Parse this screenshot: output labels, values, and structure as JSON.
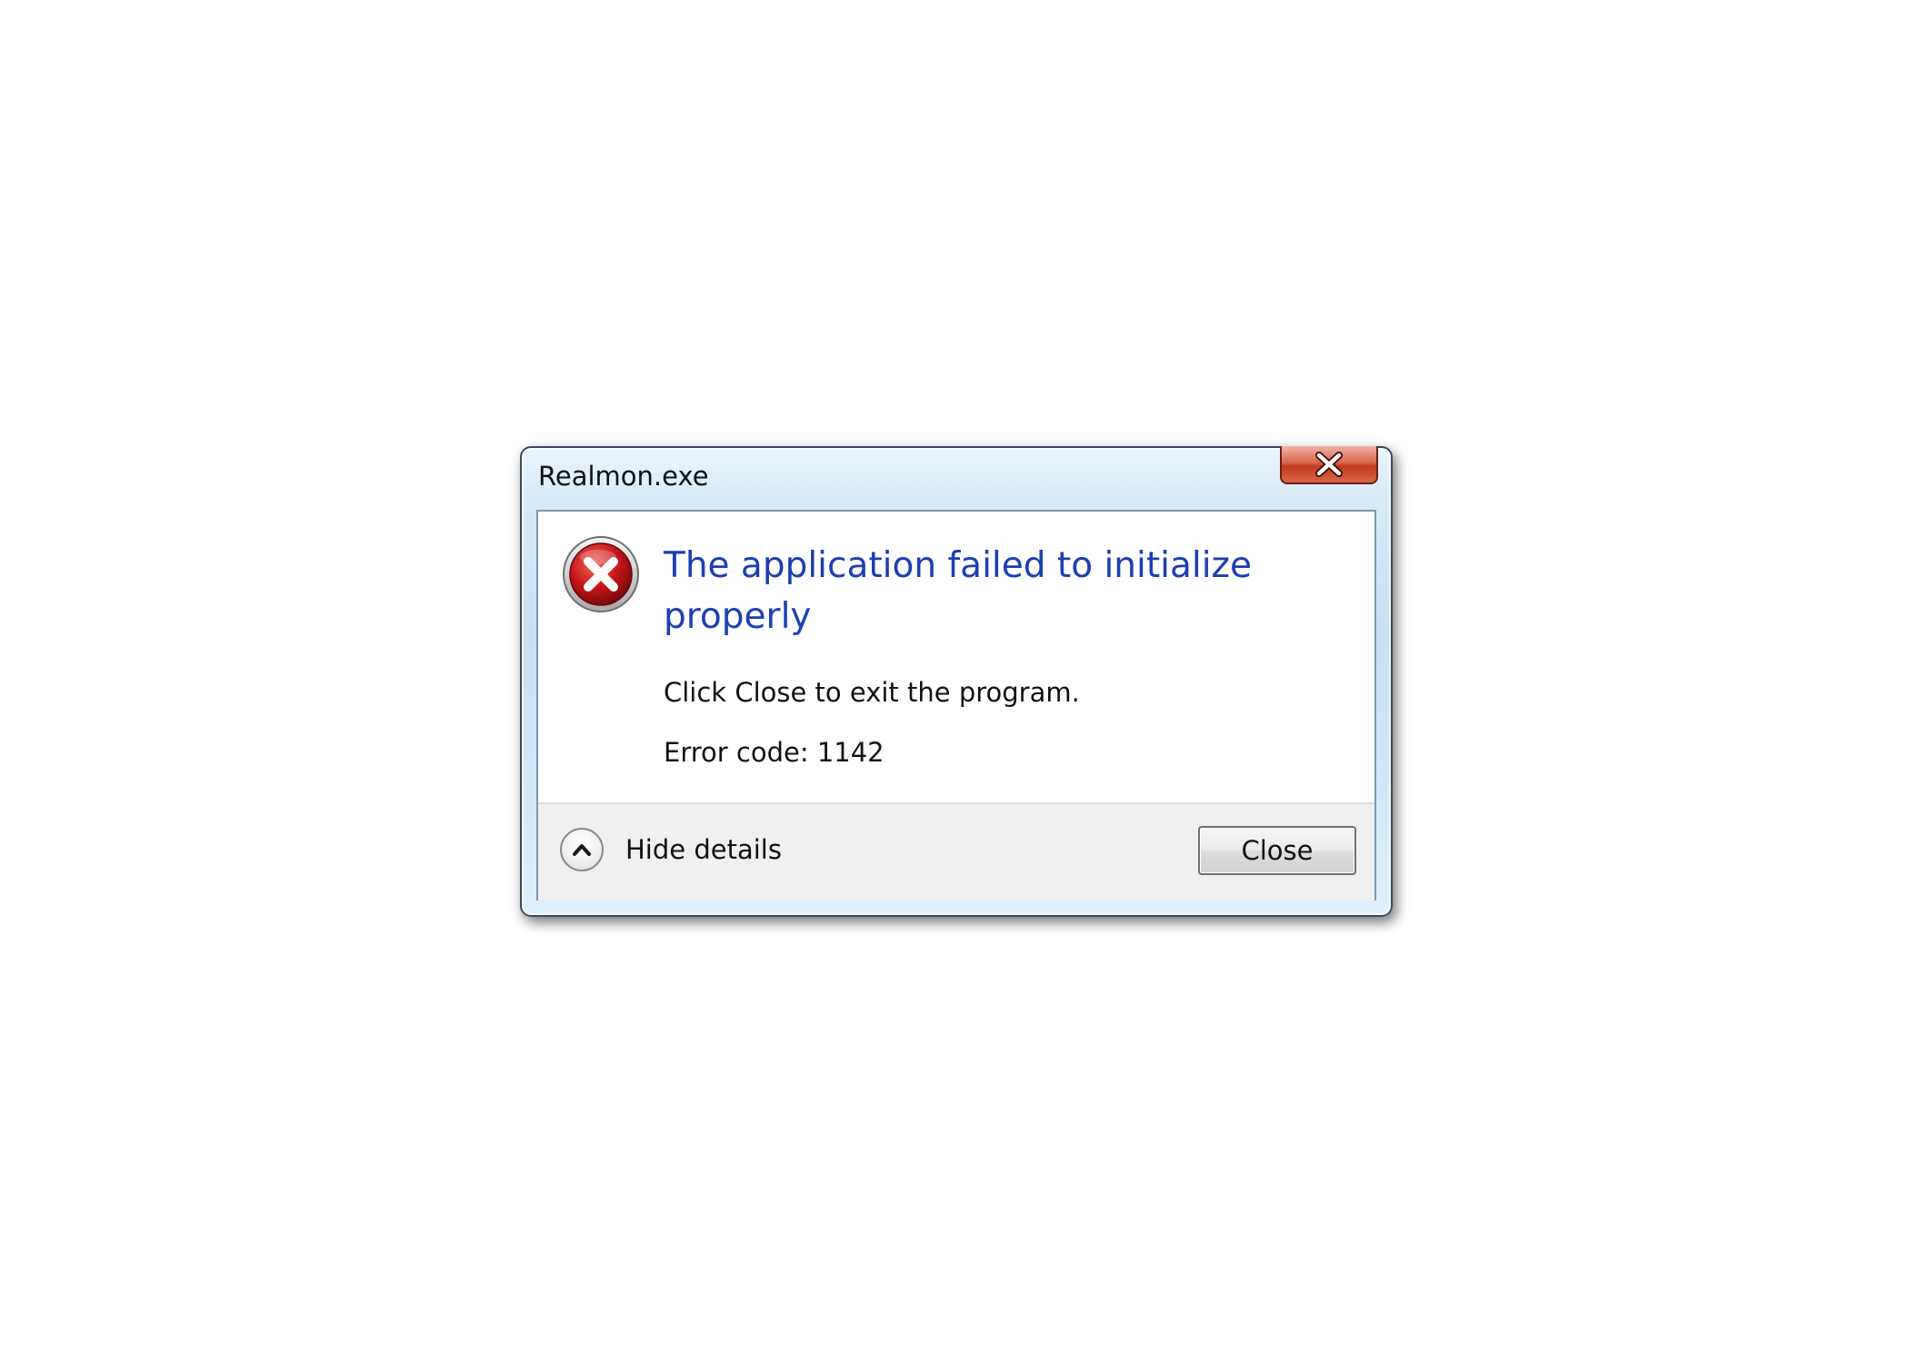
{
  "window": {
    "title": "Realmon.exe",
    "close_icon": "close-icon"
  },
  "message": {
    "icon": "error-icon",
    "main_instruction": "The application failed to initialize properly",
    "content_line1": "Click Close to exit the program.",
    "content_line2": "Error code: 1142"
  },
  "footer": {
    "expander_icon": "chevron-up-icon",
    "expander_label": "Hide details",
    "close_button_label": "Close"
  },
  "colors": {
    "main_instruction": "#1c3fb0",
    "error_red": "#c8171a",
    "close_x_red": "#c23a1f"
  }
}
